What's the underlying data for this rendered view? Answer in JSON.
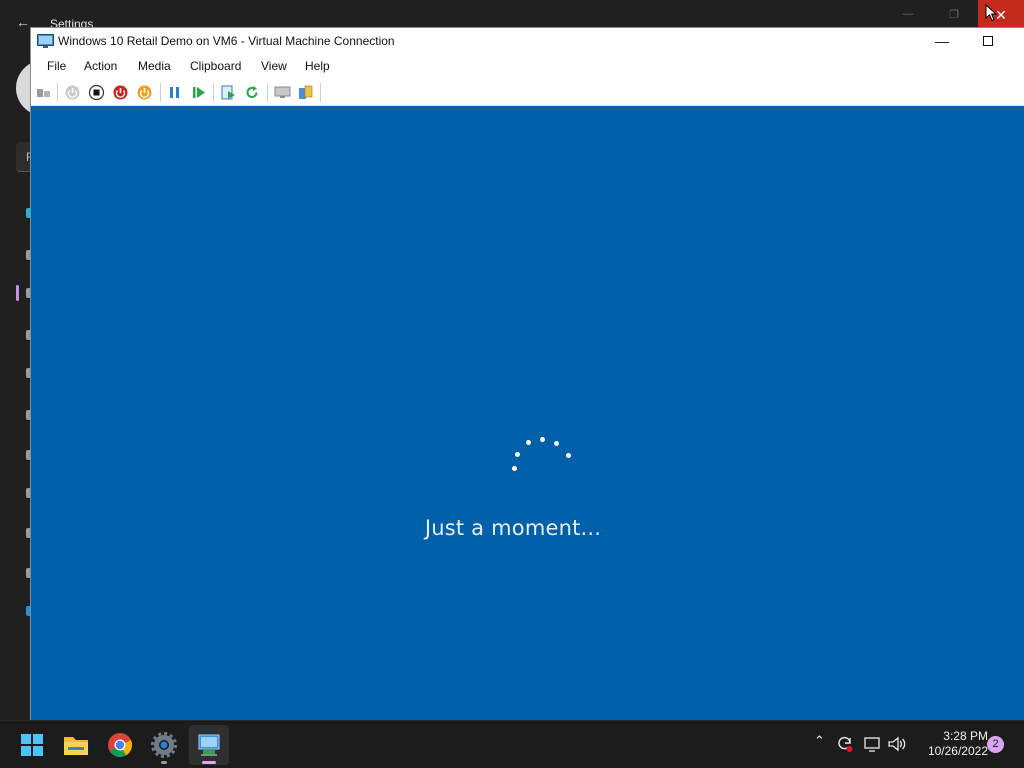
{
  "background_window": {
    "title": "Settings",
    "search_hint": "F"
  },
  "vm_window": {
    "title": "Windows 10 Retail Demo on VM6 - Virtual Machine Connection",
    "menu": [
      "File",
      "Action",
      "Media",
      "Clipboard",
      "View",
      "Help"
    ]
  },
  "guest": {
    "status_text": "Just a moment...",
    "background_color": "#0060aa"
  },
  "taskbar": {
    "time": "3:28 PM",
    "date": "10/26/2022",
    "notification_count": "2"
  },
  "colors": {
    "close_red": "#c42b1c",
    "accent_pink": "#e3a2ff"
  }
}
